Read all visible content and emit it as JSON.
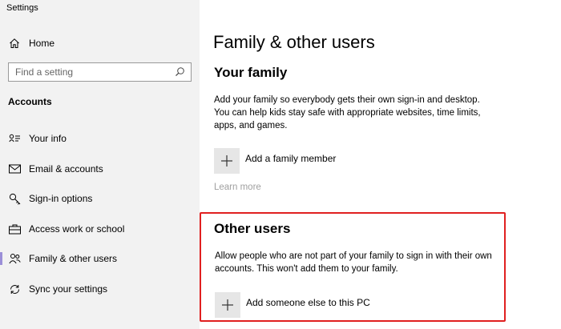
{
  "app": {
    "title": "Settings"
  },
  "sidebar": {
    "home_label": "Home",
    "search": {
      "placeholder": "Find a setting",
      "value": ""
    },
    "section_title": "Accounts",
    "items": [
      {
        "label": "Your info",
        "icon": "person-card-icon"
      },
      {
        "label": "Email & accounts",
        "icon": "mail-icon"
      },
      {
        "label": "Sign-in options",
        "icon": "key-icon"
      },
      {
        "label": "Access work or school",
        "icon": "briefcase-icon"
      },
      {
        "label": "Family & other users",
        "icon": "people-icon"
      },
      {
        "label": "Sync your settings",
        "icon": "sync-icon"
      }
    ]
  },
  "main": {
    "title": "Family & other users",
    "family": {
      "heading": "Your family",
      "description": "Add your family so everybody gets their own sign-in and desktop. You can help kids stay safe with appropriate websites, time limits, apps, and games.",
      "add_label": "Add a family member",
      "learn_more": "Learn more"
    },
    "other_users": {
      "heading": "Other users",
      "description": "Allow people who are not part of your family to sign in with their own accounts. This won't add them to your family.",
      "add_label": "Add someone else to this PC"
    }
  },
  "colors": {
    "highlight": "#e02020",
    "sidebar_bg": "#f2f2f2",
    "tile_bg": "#e6e6e6",
    "link_disabled": "#a0a0a0"
  }
}
